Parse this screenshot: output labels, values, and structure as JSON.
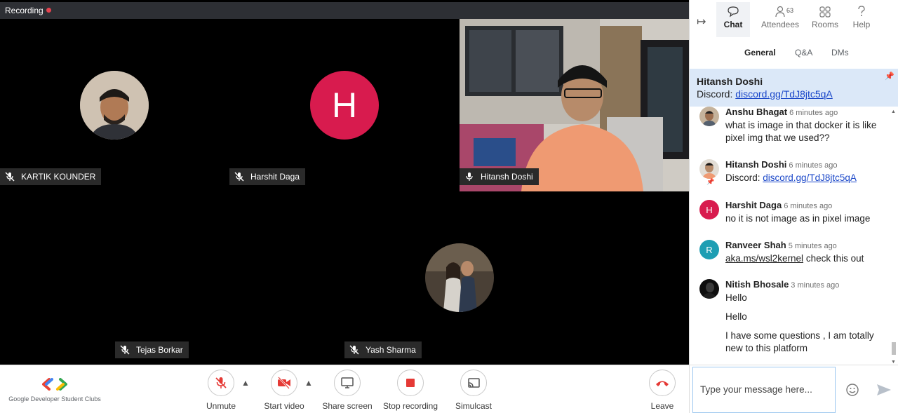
{
  "recording": {
    "label": "Recording"
  },
  "participants": [
    {
      "name": "KARTIK KOUNDER",
      "muted": true
    },
    {
      "name": "Harshit Daga",
      "muted": true,
      "initial": "H"
    },
    {
      "name": "Hitansh Doshi",
      "muted": false
    },
    {
      "name": "Tejas Borkar",
      "muted": true
    },
    {
      "name": "Yash Sharma",
      "muted": true
    }
  ],
  "brand": {
    "text": "Google Developer Student Clubs"
  },
  "controls": {
    "unmute": "Unmute",
    "start_video": "Start video",
    "share_screen": "Share screen",
    "stop_recording": "Stop recording",
    "simulcast": "Simulcast",
    "leave": "Leave"
  },
  "panel": {
    "tabs": {
      "chat": "Chat",
      "attendees": "Attendees",
      "attendees_count": "63",
      "rooms": "Rooms",
      "help": "Help"
    },
    "subtabs": {
      "general": "General",
      "qa": "Q&A",
      "dms": "DMs"
    },
    "pinned": {
      "name": "Hitansh Doshi",
      "prefix": "Discord:",
      "link": "discord.gg/TdJ8jtc5qA"
    }
  },
  "messages": [
    {
      "name": "Anshu Bhagat",
      "time": "6 minutes ago",
      "lines": [
        "what is image in that docker it is like pixel img that we used??"
      ]
    },
    {
      "name": "Hitansh Doshi",
      "time": "6 minutes ago",
      "prefix": "Discord:",
      "link": "discord.gg/TdJ8jtc5qA"
    },
    {
      "name": "Harshit Daga",
      "time": "6 minutes ago",
      "initial": "H",
      "lines": [
        "no it is not image as in pixel image"
      ]
    },
    {
      "name": "Ranveer Shah",
      "time": "5 minutes ago",
      "initial": "R",
      "link": "aka.ms/wsl2kernel",
      "suffix": "check this out"
    },
    {
      "name": "Nitish Bhosale",
      "time": "3 minutes ago",
      "lines": [
        "Hello",
        "Hello",
        "I have some questions , I am totally new to this platform"
      ]
    }
  ],
  "composer": {
    "placeholder": "Type your message here..."
  },
  "colors": {
    "accent": "#1a47c9",
    "recording": "#e5434f",
    "avatar_h": "#d81b4e",
    "avatar_r": "#1e9eb3",
    "stop": "#e53935"
  }
}
